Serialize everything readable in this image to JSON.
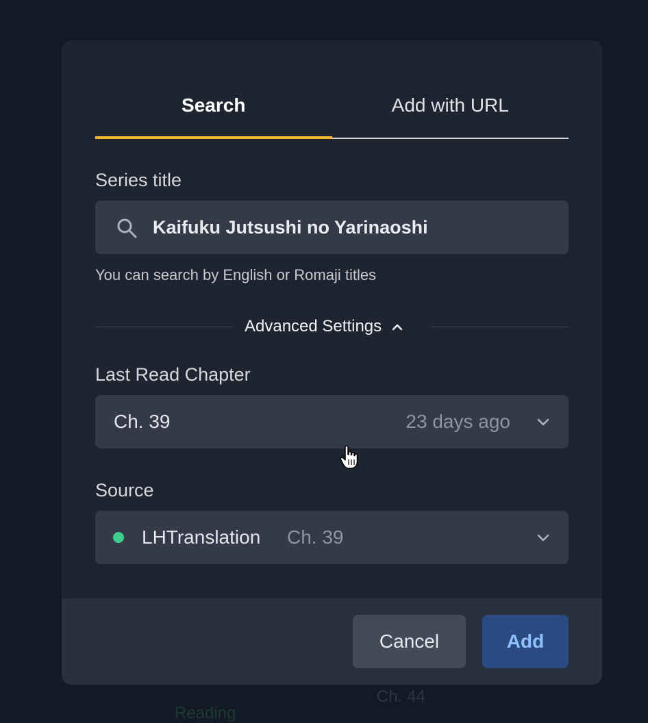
{
  "background": {
    "reading_text": "Reading",
    "chapter_text": "Ch. 44"
  },
  "tabs": [
    {
      "label": "Search",
      "active": true
    },
    {
      "label": "Add with URL",
      "active": false
    }
  ],
  "series": {
    "label": "Series title",
    "value": "Kaifuku Jutsushi no Yarinaoshi",
    "hint": "You can search by English or Romaji titles"
  },
  "advanced": {
    "label": "Advanced Settings",
    "expanded": true
  },
  "last_read": {
    "label": "Last Read Chapter",
    "value": "Ch. 39",
    "date": "23 days ago"
  },
  "source": {
    "label": "Source",
    "name": "LHTranslation",
    "chapter": "Ch. 39",
    "status_color": "#3ecf8e"
  },
  "footer": {
    "cancel_label": "Cancel",
    "add_label": "Add"
  },
  "colors": {
    "tab_accent": "#f5b82e",
    "add_button": "#2c4a82"
  }
}
